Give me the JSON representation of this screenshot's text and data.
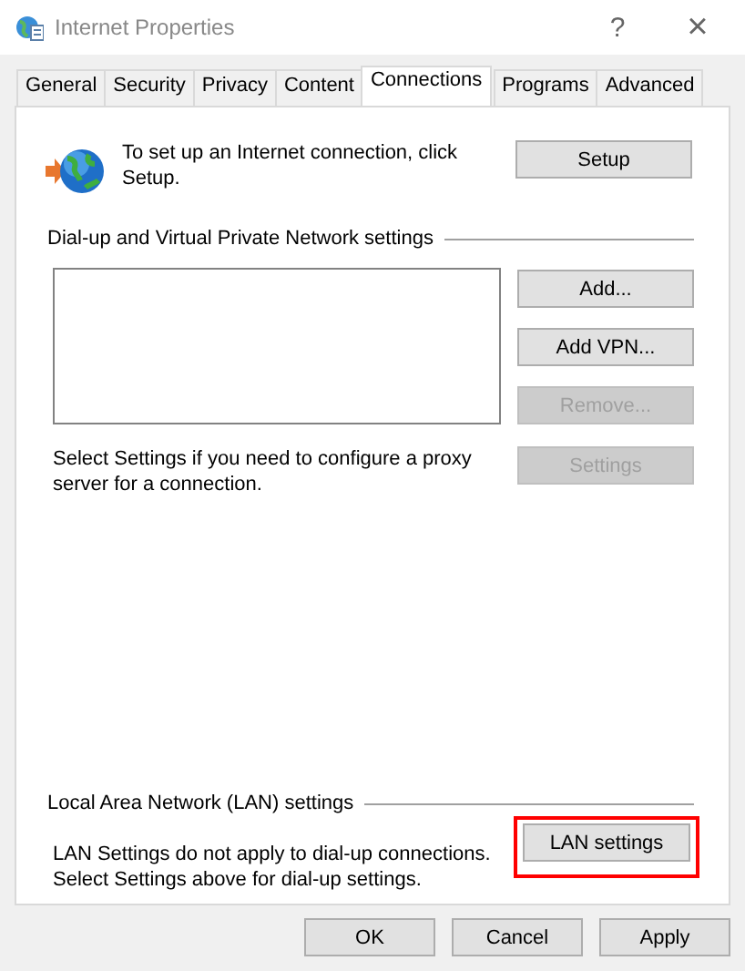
{
  "window": {
    "title": "Internet Properties",
    "help": "?",
    "close": "×"
  },
  "tabs": [
    {
      "label": "General",
      "selected": false
    },
    {
      "label": "Security",
      "selected": false
    },
    {
      "label": "Privacy",
      "selected": false
    },
    {
      "label": "Content",
      "selected": false
    },
    {
      "label": "Connections",
      "selected": true
    },
    {
      "label": "Programs",
      "selected": false
    },
    {
      "label": "Advanced",
      "selected": false
    }
  ],
  "setup": {
    "text": "To set up an Internet connection, click Setup.",
    "button": {
      "label": "Setup",
      "disabled": false
    }
  },
  "dialup": {
    "heading": "Dial-up and Virtual Private Network settings",
    "buttons": [
      {
        "label": "Add...",
        "disabled": false
      },
      {
        "label": "Add VPN...",
        "disabled": false
      },
      {
        "label": "Remove...",
        "disabled": true
      }
    ],
    "proxy_text": "Select Settings if you need to configure a proxy server for a connection.",
    "settings_button": {
      "label": "Settings",
      "disabled": true
    }
  },
  "lan": {
    "heading": "Local Area Network (LAN) settings",
    "text": "LAN Settings do not apply to dial-up connections. Select Settings above for dial-up settings.",
    "button": {
      "label": "LAN settings",
      "disabled": false,
      "highlighted": true
    }
  },
  "footer_buttons": [
    {
      "label": "OK",
      "disabled": false
    },
    {
      "label": "Cancel",
      "disabled": false
    },
    {
      "label": "Apply",
      "disabled": false
    }
  ]
}
